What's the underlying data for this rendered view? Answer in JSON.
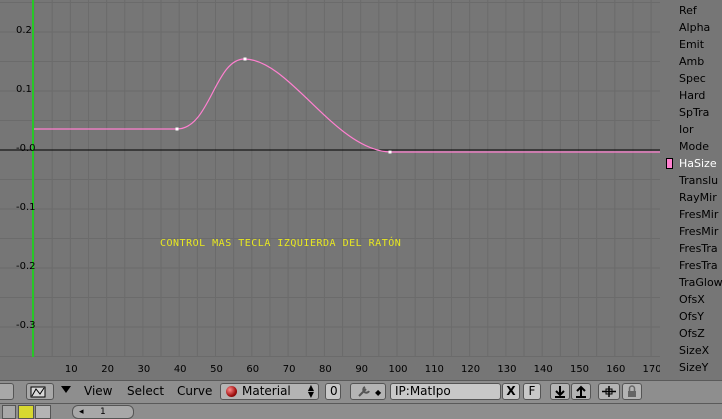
{
  "graph": {
    "y_ticks": [
      "0.2",
      "0.1",
      "-0.0",
      "-0.1",
      "-0.2",
      "-0.3"
    ],
    "x_ticks": [
      "10",
      "20",
      "30",
      "40",
      "50",
      "60",
      "70",
      "80",
      "90",
      "100",
      "110",
      "120",
      "130",
      "140",
      "150",
      "160",
      "170"
    ],
    "annotation": "CONTROL MAS TECLA IZQUIERDA DEL RATÓN",
    "curve_color": "#ff80d0",
    "grid_color": "#6b6b6b",
    "axis_color": "#26c826"
  },
  "channels": [
    {
      "label": "Ref",
      "active": false
    },
    {
      "label": "Alpha",
      "active": false
    },
    {
      "label": "Emit",
      "active": false
    },
    {
      "label": "Amb",
      "active": false
    },
    {
      "label": "Spec",
      "active": false
    },
    {
      "label": "Hard",
      "active": false
    },
    {
      "label": "SpTra",
      "active": false
    },
    {
      "label": "Ior",
      "active": false
    },
    {
      "label": "Mode",
      "active": false
    },
    {
      "label": "HaSize",
      "active": true
    },
    {
      "label": "Translu",
      "active": false
    },
    {
      "label": "RayMir",
      "active": false
    },
    {
      "label": "FresMir",
      "active": false
    },
    {
      "label": "FresMir",
      "active": false
    },
    {
      "label": "FresTra",
      "active": false
    },
    {
      "label": "FresTra",
      "active": false
    },
    {
      "label": "TraGlow",
      "active": false
    },
    {
      "label": "OfsX",
      "active": false
    },
    {
      "label": "OfsY",
      "active": false
    },
    {
      "label": "OfsZ",
      "active": false
    },
    {
      "label": "SizeX",
      "active": false
    },
    {
      "label": "SizeY",
      "active": false
    }
  ],
  "header": {
    "view": "View",
    "select": "Select",
    "curve": "Curve",
    "block_type": "Material",
    "block_index": "0",
    "ipo_name": "IP:MatIpo",
    "close": "X",
    "fake_user": "F"
  },
  "bottom": {
    "value": "1"
  }
}
